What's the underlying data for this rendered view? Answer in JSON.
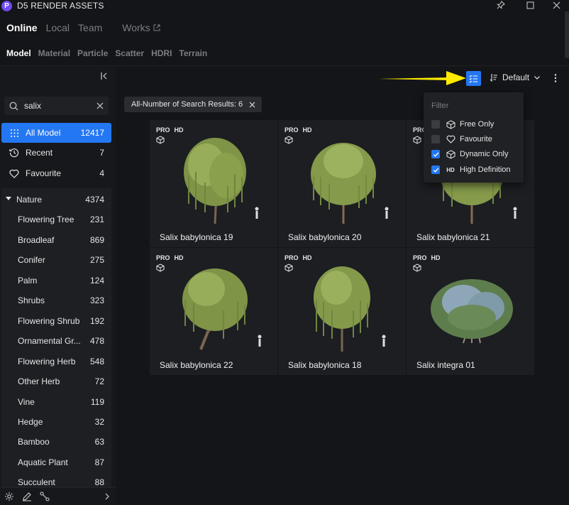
{
  "app": {
    "logo_letter": "P",
    "title": "D5 RENDER ASSETS"
  },
  "top_tabs": [
    {
      "label": "Online",
      "active": true
    },
    {
      "label": "Local",
      "active": false
    },
    {
      "label": "Team",
      "active": false
    },
    {
      "label": "Works",
      "active": false
    }
  ],
  "category_tabs": [
    {
      "label": "Model",
      "active": true
    },
    {
      "label": "Material",
      "active": false
    },
    {
      "label": "Particle",
      "active": false
    },
    {
      "label": "Scatter",
      "active": false
    },
    {
      "label": "HDRI",
      "active": false
    },
    {
      "label": "Terrain",
      "active": false
    }
  ],
  "search": {
    "value": "salix",
    "placeholder": ""
  },
  "nav": [
    {
      "label": "All Model",
      "count": "12417",
      "icon": "grid-dots-icon",
      "active": true
    },
    {
      "label": "Recent",
      "count": "7",
      "icon": "clock-history-icon",
      "active": false
    },
    {
      "label": "Favourite",
      "count": "4",
      "icon": "heart-icon",
      "active": false
    }
  ],
  "nature": {
    "label": "Nature",
    "count": "4374",
    "items": [
      {
        "label": "Flowering Tree",
        "count": "231"
      },
      {
        "label": "Broadleaf",
        "count": "869"
      },
      {
        "label": "Conifer",
        "count": "275"
      },
      {
        "label": "Palm",
        "count": "124"
      },
      {
        "label": "Shrubs",
        "count": "323"
      },
      {
        "label": "Flowering Shrub",
        "count": "192"
      },
      {
        "label": "Ornamental Gr...",
        "count": "478"
      },
      {
        "label": "Flowering Herb",
        "count": "548"
      },
      {
        "label": "Other Herb",
        "count": "72"
      },
      {
        "label": "Vine",
        "count": "119"
      },
      {
        "label": "Hedge",
        "count": "32"
      },
      {
        "label": "Bamboo",
        "count": "63"
      },
      {
        "label": "Aquatic Plant",
        "count": "87"
      },
      {
        "label": "Succulent",
        "count": "88"
      }
    ]
  },
  "toolbar": {
    "sort_label": "Default"
  },
  "results_chip": {
    "label": "All-Number of Search Results: 6"
  },
  "cards": [
    {
      "name": "Salix babylonica 19",
      "badge_pro": "PRO",
      "badge_hd": "HD"
    },
    {
      "name": "Salix babylonica 20",
      "badge_pro": "PRO",
      "badge_hd": "HD"
    },
    {
      "name": "Salix babylonica 21",
      "badge_pro": "PRO",
      "badge_hd": "HD"
    },
    {
      "name": "Salix babylonica 22",
      "badge_pro": "PRO",
      "badge_hd": "HD"
    },
    {
      "name": "Salix babylonica 18",
      "badge_pro": "PRO",
      "badge_hd": "HD"
    },
    {
      "name": "Salix integra 01",
      "badge_pro": "PRO",
      "badge_hd": "HD"
    }
  ],
  "filter_menu": {
    "title": "Filter",
    "options": [
      {
        "label": "Free Only",
        "checked": false,
        "icon": "free-cube-icon"
      },
      {
        "label": "Favourite",
        "checked": false,
        "icon": "heart-icon"
      },
      {
        "label": "Dynamic Only",
        "checked": true,
        "icon": "dynamic-cube-icon"
      },
      {
        "label": "High Definition",
        "checked": true,
        "icon_text": "HD"
      }
    ]
  },
  "colors": {
    "accent": "#2477f2",
    "background": "#141518",
    "sidebar": "#17181b",
    "card": "#1c1e22",
    "annotation_arrow": "#ffeb00"
  }
}
